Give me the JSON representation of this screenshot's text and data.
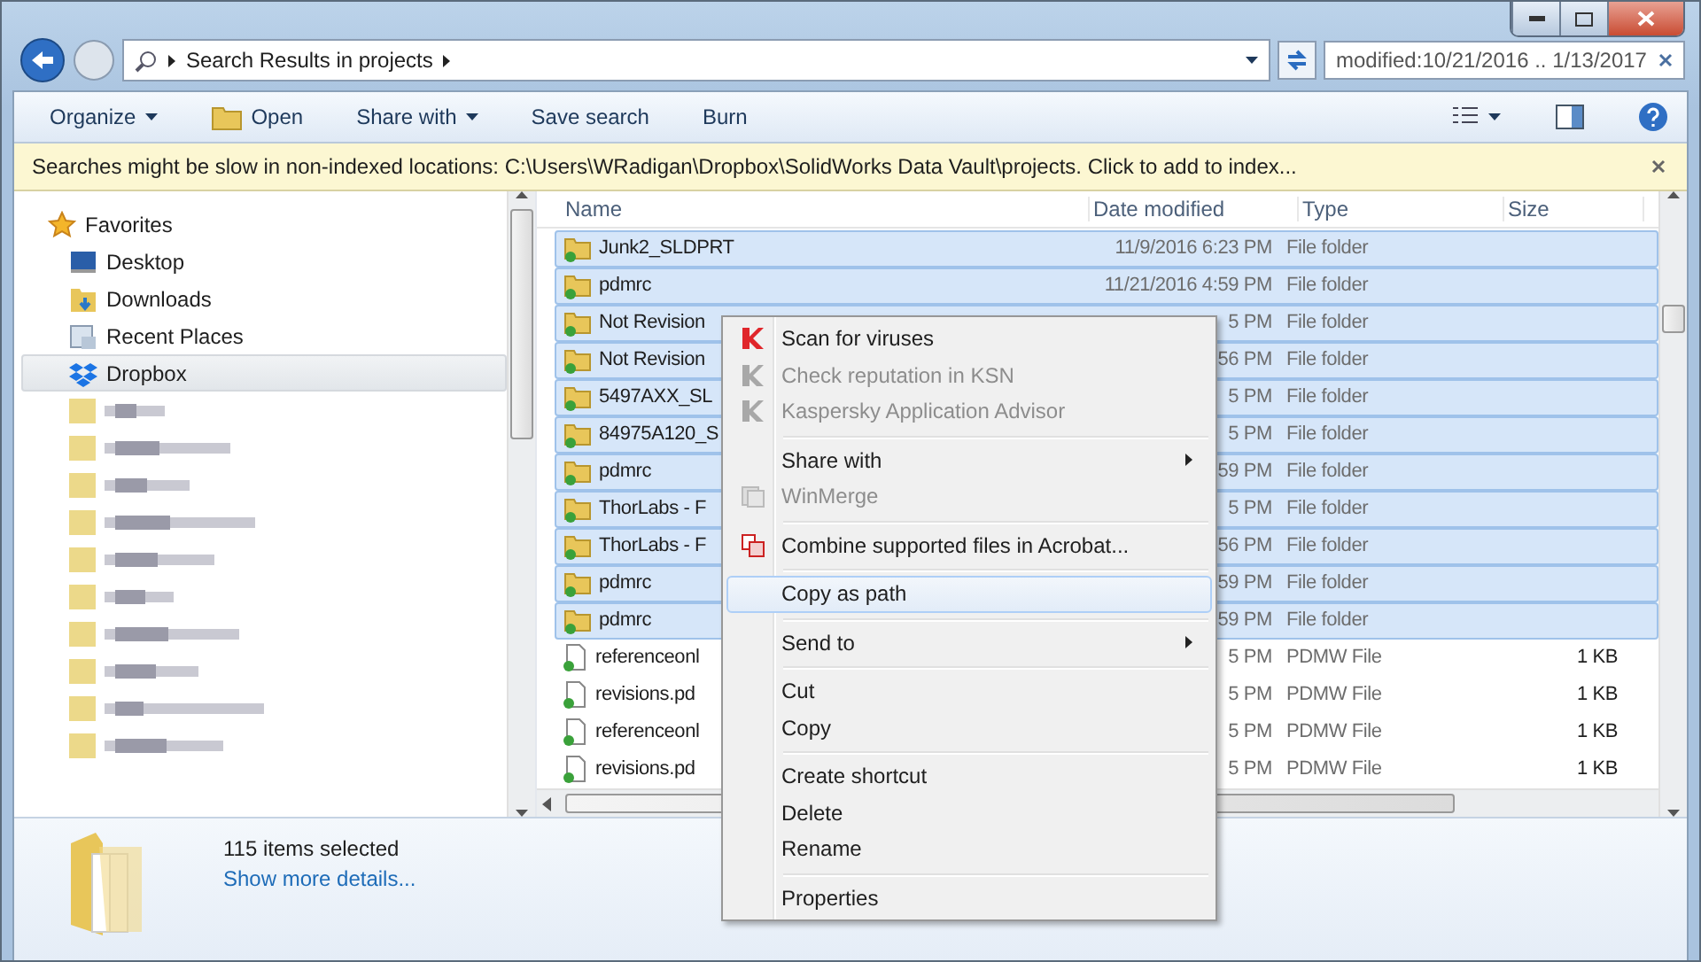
{
  "address": {
    "breadcrumb": "Search Results in projects"
  },
  "search": {
    "value": "modified:10/21/2016 .. 1/13/2017"
  },
  "toolbar": [
    {
      "label": "Organize",
      "kind": "menu"
    },
    {
      "label": "Open",
      "kind": "icon"
    },
    {
      "label": "Share with",
      "kind": "menu"
    },
    {
      "label": "Save search",
      "kind": "plain"
    },
    {
      "label": "Burn",
      "kind": "plain"
    }
  ],
  "info_bar": {
    "text": "Searches might be slow in non-indexed locations: C:\\Users\\WRadigan\\Dropbox\\SolidWorks Data Vault\\projects. Click to add to index..."
  },
  "sidebar": {
    "favorites": "Favorites",
    "items": [
      {
        "label": "Desktop",
        "kind": "desktop",
        "selected": false
      },
      {
        "label": "Downloads",
        "kind": "downloads",
        "selected": false
      },
      {
        "label": "Recent Places",
        "kind": "recent",
        "selected": false
      },
      {
        "label": "Dropbox",
        "kind": "dropbox",
        "selected": true
      }
    ]
  },
  "table": {
    "columns": [
      "Name",
      "Date modified",
      "Type",
      "Size"
    ],
    "rows": [
      {
        "name": "Junk2_SLDPRT",
        "date": "11/9/2016 6:23 PM",
        "type": "File folder",
        "size": "",
        "kind": "folder",
        "selected": true
      },
      {
        "name": "pdmrc",
        "date": "11/21/2016 4:59 PM",
        "type": "File folder",
        "size": "",
        "kind": "folder",
        "selected": true
      },
      {
        "name": "Not Revision",
        "date": "5 PM",
        "type": "File folder",
        "size": "",
        "kind": "folder",
        "selected": true
      },
      {
        "name": "Not Revision",
        "date": "56 PM",
        "type": "File folder",
        "size": "",
        "kind": "folder",
        "selected": true
      },
      {
        "name": "5497AXX_SL",
        "date": "5 PM",
        "type": "File folder",
        "size": "",
        "kind": "folder",
        "selected": true
      },
      {
        "name": "84975A120_S",
        "date": "5 PM",
        "type": "File folder",
        "size": "",
        "kind": "folder",
        "selected": true
      },
      {
        "name": "pdmrc",
        "date": "59 PM",
        "type": "File folder",
        "size": "",
        "kind": "folder",
        "selected": true
      },
      {
        "name": "ThorLabs - F",
        "date": "5 PM",
        "type": "File folder",
        "size": "",
        "kind": "folder",
        "selected": true
      },
      {
        "name": "ThorLabs - F",
        "date": "56 PM",
        "type": "File folder",
        "size": "",
        "kind": "folder",
        "selected": true
      },
      {
        "name": "pdmrc",
        "date": "59 PM",
        "type": "File folder",
        "size": "",
        "kind": "folder",
        "selected": true
      },
      {
        "name": "pdmrc",
        "date": "59 PM",
        "type": "File folder",
        "size": "",
        "kind": "folder",
        "selected": true
      },
      {
        "name": "referenceonl",
        "date": "5 PM",
        "type": "PDMW File",
        "size": "1 KB",
        "kind": "file",
        "selected": false
      },
      {
        "name": "revisions.pd",
        "date": "5 PM",
        "type": "PDMW File",
        "size": "1 KB",
        "kind": "file",
        "selected": false
      },
      {
        "name": "referenceonl",
        "date": "5 PM",
        "type": "PDMW File",
        "size": "1 KB",
        "kind": "file",
        "selected": false
      },
      {
        "name": "revisions.pd",
        "date": "5 PM",
        "type": "PDMW File",
        "size": "1 KB",
        "kind": "file",
        "selected": false
      }
    ]
  },
  "context_menu": [
    {
      "label": "Scan for viruses",
      "kind": "kaspersky",
      "disabled": false,
      "selected": false,
      "submenu": false
    },
    {
      "label": "Check reputation in KSN",
      "kind": "kaspersky",
      "disabled": true,
      "selected": false,
      "submenu": false
    },
    {
      "label": "Kaspersky Application Advisor",
      "kind": "kaspersky",
      "disabled": true,
      "selected": false,
      "submenu": false
    },
    {
      "kind": "separator"
    },
    {
      "label": "Share with",
      "kind": "plain",
      "disabled": false,
      "selected": false,
      "submenu": true
    },
    {
      "label": "WinMerge",
      "kind": "winmerge",
      "disabled": true,
      "selected": false,
      "submenu": false
    },
    {
      "kind": "separator"
    },
    {
      "label": "Combine supported files in Acrobat...",
      "kind": "acrobat",
      "disabled": false,
      "selected": false,
      "submenu": false
    },
    {
      "kind": "separator"
    },
    {
      "label": "Copy as path",
      "kind": "plain",
      "disabled": false,
      "selected": true,
      "submenu": false
    },
    {
      "kind": "separator"
    },
    {
      "label": "Send to",
      "kind": "plain",
      "disabled": false,
      "selected": false,
      "submenu": true
    },
    {
      "kind": "separator"
    },
    {
      "label": "Cut",
      "kind": "plain",
      "disabled": false,
      "selected": false,
      "submenu": false
    },
    {
      "label": "Copy",
      "kind": "plain",
      "disabled": false,
      "selected": false,
      "submenu": false
    },
    {
      "kind": "separator"
    },
    {
      "label": "Create shortcut",
      "kind": "plain",
      "disabled": false,
      "selected": false,
      "submenu": false
    },
    {
      "label": "Delete",
      "kind": "plain",
      "disabled": false,
      "selected": false,
      "submenu": false
    },
    {
      "label": "Rename",
      "kind": "plain",
      "disabled": false,
      "selected": false,
      "submenu": false
    },
    {
      "kind": "separator"
    },
    {
      "label": "Properties",
      "kind": "plain",
      "disabled": false,
      "selected": false,
      "submenu": false
    }
  ],
  "details": {
    "count": "115 items selected",
    "link": "Show more details..."
  }
}
